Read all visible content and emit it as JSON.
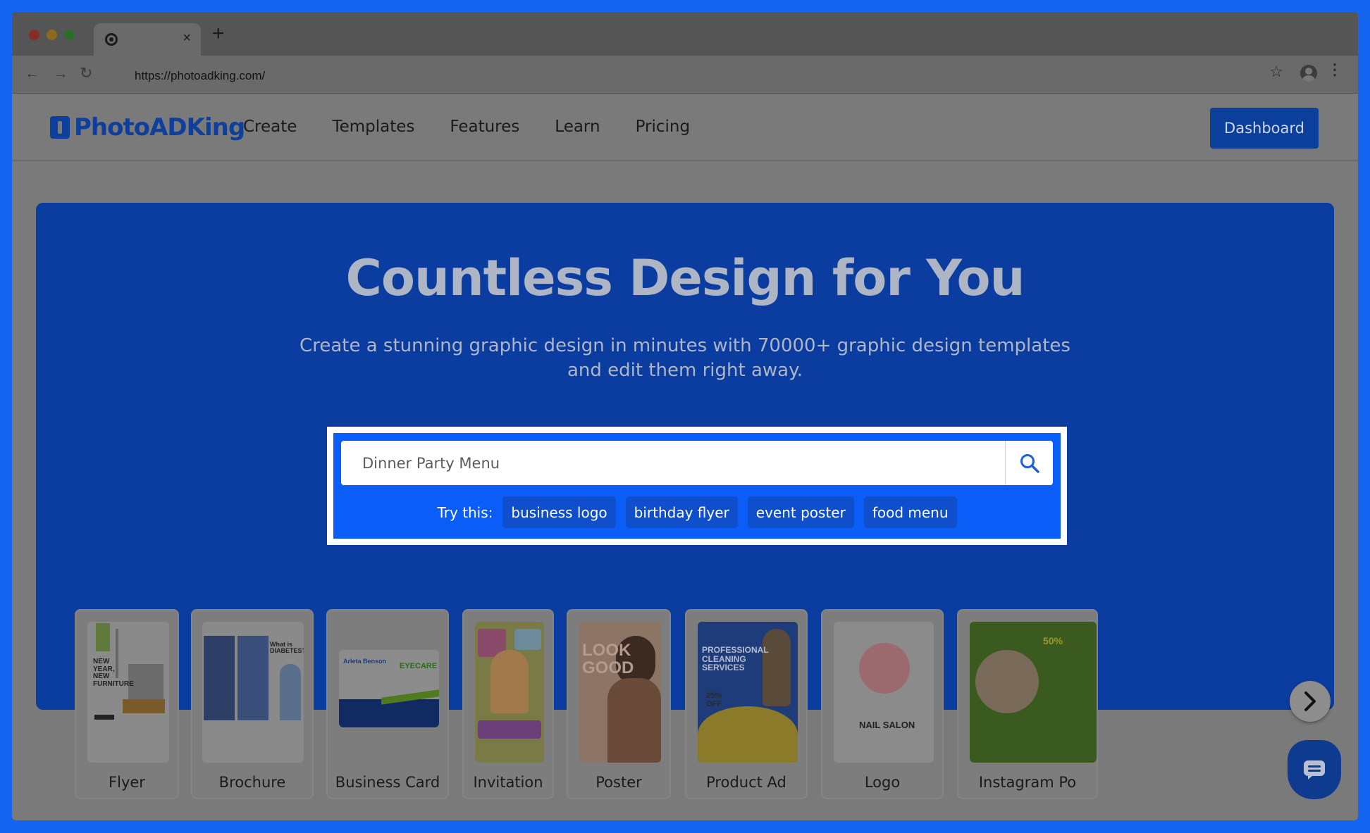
{
  "browser": {
    "tab_close": "×",
    "new_tab": "+",
    "url": "https://photoadking.com/"
  },
  "site": {
    "logo_text": "PhotoADKing",
    "nav": [
      "Create",
      "Templates",
      "Features",
      "Learn",
      "Pricing"
    ],
    "dashboard_label": "Dashboard"
  },
  "hero": {
    "title": "Countless Design for You",
    "subtitle": "Create a stunning graphic design in minutes with 70000+ graphic design templates and edit them right away."
  },
  "search": {
    "placeholder": "Dinner Party Menu",
    "try_label": "Try this:",
    "suggestions": [
      "business logo",
      "birthday flyer",
      "event poster",
      "food menu"
    ]
  },
  "categories": [
    {
      "label": "Flyer",
      "thumb_text": "NEW YEAR, NEW FURNITURE"
    },
    {
      "label": "Brochure",
      "thumb_text": "What is DIABETES?"
    },
    {
      "label": "Business Card",
      "thumb_text": "EYECARE",
      "thumb_sub": "Arleta Benson"
    },
    {
      "label": "Invitation",
      "thumb_text": ""
    },
    {
      "label": "Poster",
      "thumb_text": "LOOK GOOD"
    },
    {
      "label": "Product Ad",
      "thumb_text": "PROFESSIONAL CLEANING SERVICES",
      "thumb_sub": "25% OFF"
    },
    {
      "label": "Logo",
      "thumb_text": "NAIL SALON"
    },
    {
      "label": "Instagram Po",
      "thumb_text": "50%"
    }
  ],
  "colors": {
    "page_border": "#1565f0",
    "hero_bg": "#0b3da0",
    "search_bg": "#0a5df7",
    "dashboard_bg": "#0c3f9c"
  }
}
